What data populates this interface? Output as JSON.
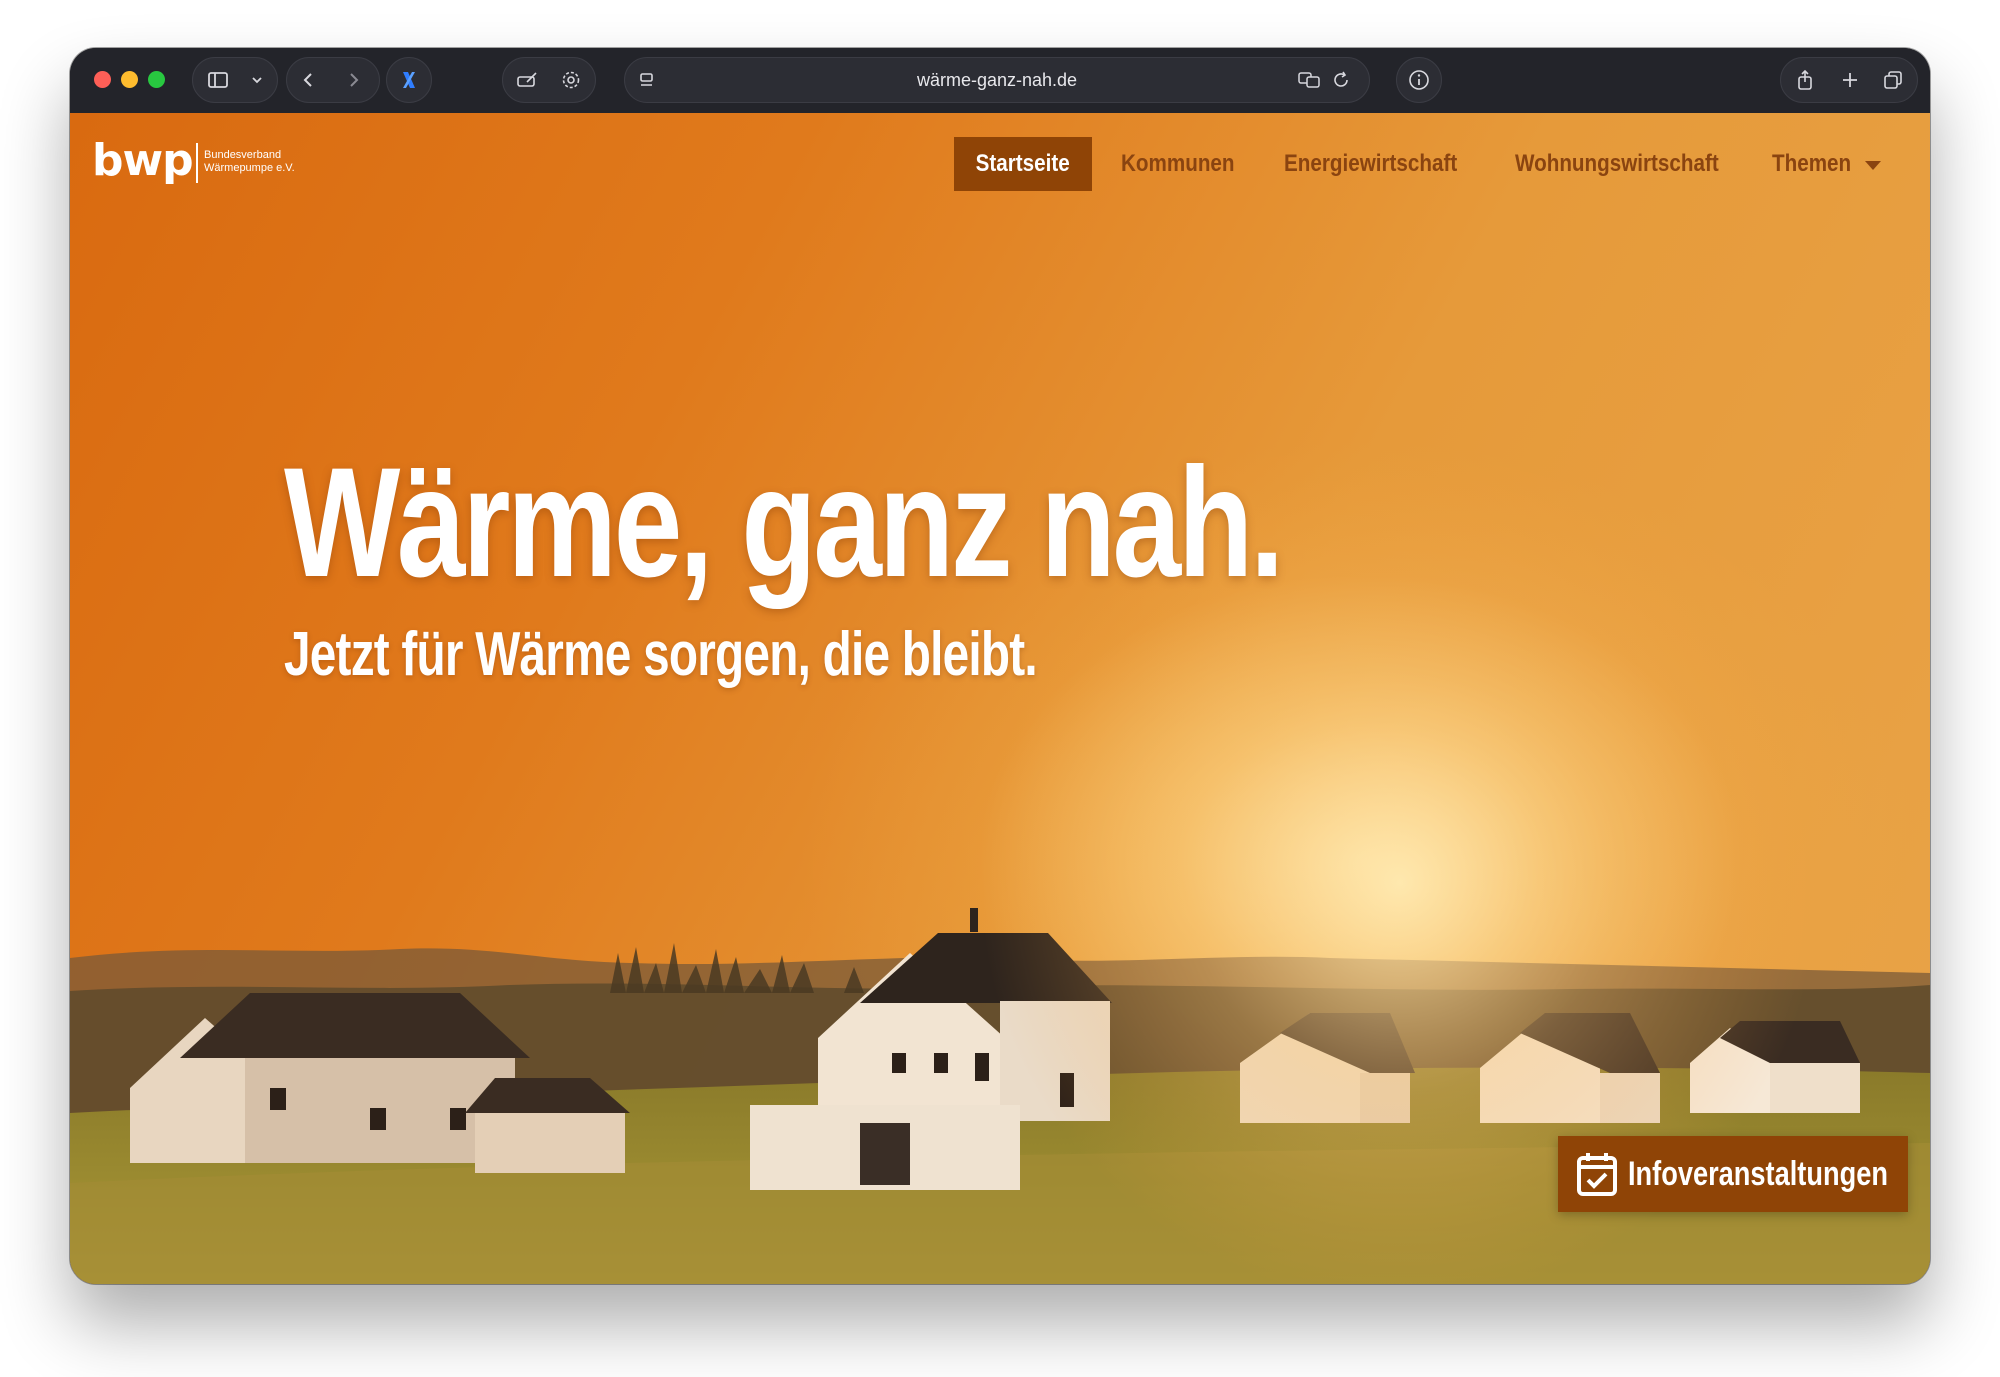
{
  "browser": {
    "url": "wärme-ganz-nah.de"
  },
  "site": {
    "logo": {
      "wordmark": "bwp",
      "subtitle_line1": "Bundesverband",
      "subtitle_line2": "Wärmepumpe e.V."
    },
    "nav": {
      "items": [
        {
          "label": "Startseite",
          "active": true
        },
        {
          "label": "Kommunen",
          "active": false
        },
        {
          "label": "Energiewirtschaft",
          "active": false
        },
        {
          "label": "Wohnungswirtschaft",
          "active": false
        },
        {
          "label": "Themen",
          "active": false,
          "has_dropdown": true
        }
      ]
    },
    "hero": {
      "headline": "Wärme, ganz nah.",
      "subheadline": "Jetzt für Wärme sorgen, die bleibt."
    },
    "cta": {
      "label": "Infoveranstaltungen",
      "icon": "calendar-check-icon"
    }
  },
  "colors": {
    "accent": "#8f4406",
    "hero_orange": "#e07a1c",
    "nav_text": "#8a4410"
  }
}
